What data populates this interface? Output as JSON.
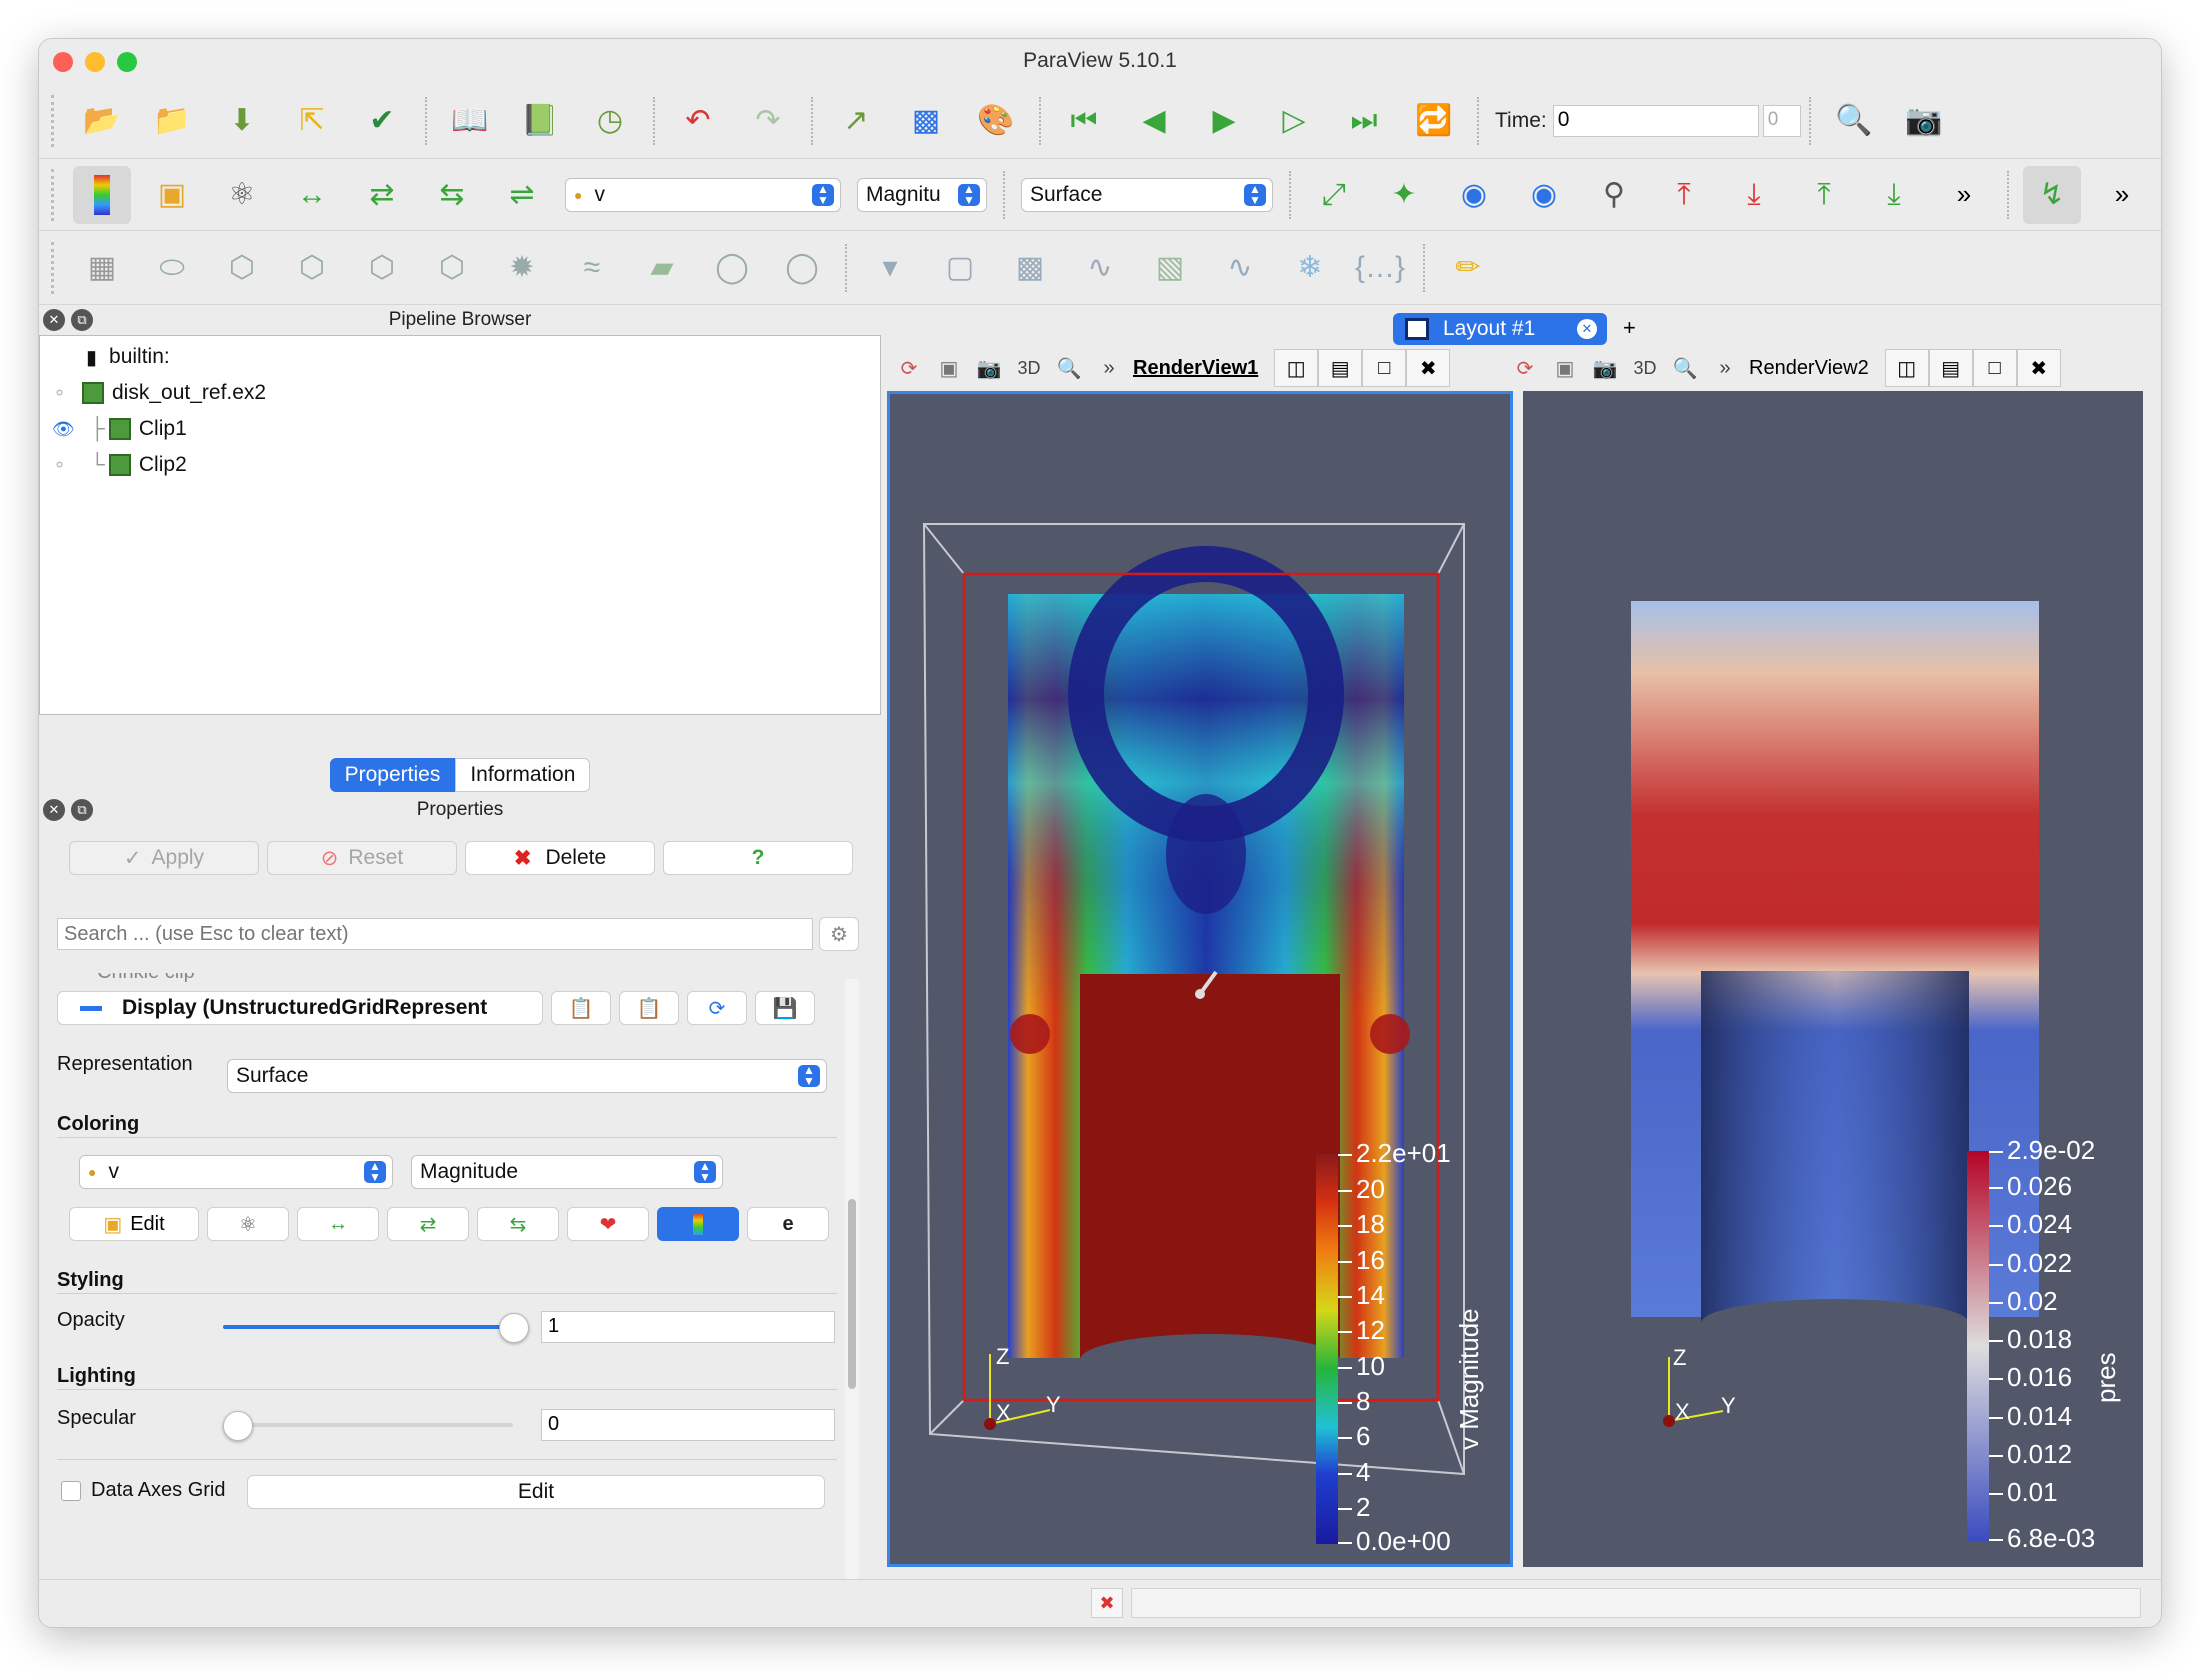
{
  "app": {
    "title": "ParaView 5.10.1"
  },
  "toolbar1": {
    "time_label": "Time:",
    "time_value": "0",
    "time_index": "0"
  },
  "toolbar2": {
    "array_value": "v",
    "component_value": "Magnitu",
    "representation_value": "Surface"
  },
  "pipeline": {
    "title": "Pipeline Browser",
    "items": [
      {
        "label": "builtin:"
      },
      {
        "label": "disk_out_ref.ex2"
      },
      {
        "label": "Clip1"
      },
      {
        "label": "Clip2"
      }
    ]
  },
  "tabs": {
    "properties": "Properties",
    "information": "Information"
  },
  "properties": {
    "title": "Properties",
    "apply": "Apply",
    "reset": "Reset",
    "delete": "Delete",
    "help": "?",
    "search_placeholder": "Search ... (use Esc to clear text)",
    "partial_item": "Crinkle clip",
    "display_label": "Display (UnstructuredGridRepresent",
    "representation_label": "Representation",
    "representation_value": "Surface",
    "coloring_section": "Coloring",
    "coloring_array": "v",
    "coloring_component": "Magnitude",
    "edit_label": "Edit",
    "styling_section": "Styling",
    "opacity_label": "Opacity",
    "opacity_value": "1",
    "opacity_level": 1.0,
    "lighting_section": "Lighting",
    "specular_label": "Specular",
    "specular_value": "0",
    "specular_level": 0.0,
    "data_axes_grid": "Data Axes Grid",
    "data_axes_edit": "Edit"
  },
  "layout": {
    "tab_label": "Layout #1",
    "add_label": "+"
  },
  "views": {
    "view1": {
      "label": "RenderView1",
      "mode": "3D"
    },
    "view2": {
      "label": "RenderView2",
      "mode": "3D"
    }
  },
  "colorbar1": {
    "title": "v Magnitude",
    "labels": [
      "2.2e+01",
      "20",
      "18",
      "16",
      "14",
      "12",
      "10",
      "8",
      "6",
      "4",
      "2",
      "0.0e+00"
    ]
  },
  "colorbar2": {
    "title": "pres",
    "labels": [
      "2.9e-02",
      "0.026",
      "0.024",
      "0.022",
      "0.02",
      "0.018",
      "0.016",
      "0.014",
      "0.012",
      "0.01",
      "6.8e-03"
    ]
  },
  "axes": {
    "x": "X",
    "y": "Y",
    "z": "Z"
  },
  "colors": {
    "accent": "#2b73e6",
    "render_bg": "#525769"
  }
}
